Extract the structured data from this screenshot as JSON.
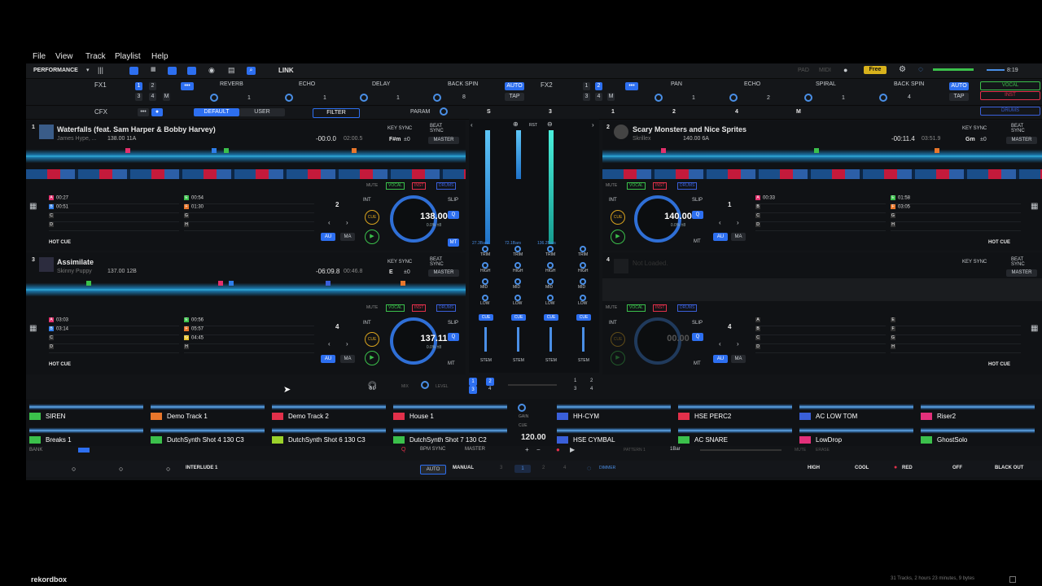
{
  "menu": [
    "File",
    "View",
    "Track",
    "Playlist",
    "Help"
  ],
  "toolbar": {
    "mode": "PERFORMANCE",
    "zoom": "100%",
    "link": "LINK",
    "pad": "PAD",
    "midi": "MIDI",
    "plan": "Free",
    "clock": "8:19"
  },
  "fx1": {
    "label": "FX1",
    "effects": [
      "REVERB",
      "ECHO",
      "DELAY",
      "BACK SPIN"
    ],
    "beat_values": [
      "1",
      "1",
      "1",
      "8"
    ],
    "auto": "AUTO",
    "tap": "TAP",
    "deck_buttons": [
      "1",
      "2",
      "3",
      "4",
      "M"
    ]
  },
  "fx2": {
    "label": "FX2",
    "effects": [
      "PAN",
      "ECHO",
      "SPIRAL",
      "BACK SPIN"
    ],
    "beat_values": [
      "1",
      "2",
      "1",
      "4"
    ],
    "auto": "AUTO",
    "tap": "TAP",
    "deck_buttons": [
      "1",
      "2",
      "3",
      "4",
      "M"
    ]
  },
  "stem_filters": [
    "VOCAL",
    "INST",
    "DRUMS"
  ],
  "cfx": {
    "label": "CFX",
    "default": "DEFAULT",
    "user": "USER",
    "filter": "FILTER",
    "param": "PARAM",
    "s": "S",
    "nums": [
      "3",
      "1",
      "2",
      "4",
      "M"
    ]
  },
  "decks": [
    {
      "num": "1",
      "title": "Waterfalls (feat. Sam Harper & Bobby Harvey)",
      "artist": "James Hype, ...",
      "bpm_key": "138.00  11A",
      "remain": "-00:0.0",
      "total": "02:00.5",
      "key": "F#m",
      "keyoff": "±0",
      "jog_bpm": "138.00",
      "jog_sub": "0.0% ±8",
      "beat_num": "2",
      "hotcues": [
        {
          "l": "A",
          "t": "00:27",
          "c": "#e2306c"
        },
        {
          "l": "B",
          "t": "00:51",
          "c": "#2e7de9"
        },
        {
          "l": "C",
          "t": "",
          "c": "#333"
        },
        {
          "l": "D",
          "t": "",
          "c": "#333"
        },
        {
          "l": "E",
          "t": "00:54",
          "c": "#3bc04b"
        },
        {
          "l": "F",
          "t": "01:30",
          "c": "#e8762b"
        },
        {
          "l": "G",
          "t": "",
          "c": "#333"
        },
        {
          "l": "H",
          "t": "",
          "c": "#333"
        }
      ]
    },
    {
      "num": "2",
      "title": "Scary Monsters and Nice Sprites",
      "artist": "Skrillex",
      "bpm_key": "140.00  6A",
      "remain": "-00:11.4",
      "total": "03:51.9",
      "key": "Gm",
      "keyoff": "±0",
      "jog_bpm": "140.00",
      "jog_sub": "0.0% ±8",
      "beat_num": "1",
      "hotcues": [
        {
          "l": "A",
          "t": "00:33",
          "c": "#e2306c"
        },
        {
          "l": "B",
          "t": "",
          "c": "#333"
        },
        {
          "l": "C",
          "t": "",
          "c": "#333"
        },
        {
          "l": "D",
          "t": "",
          "c": "#333"
        },
        {
          "l": "E",
          "t": "01:58",
          "c": "#3bc04b"
        },
        {
          "l": "F",
          "t": "03:05",
          "c": "#e8762b"
        },
        {
          "l": "G",
          "t": "",
          "c": "#333"
        },
        {
          "l": "H",
          "t": "",
          "c": "#333"
        }
      ]
    },
    {
      "num": "3",
      "title": "Assimilate",
      "artist": "Skinny Puppy",
      "bpm_key": "137.00  12B",
      "remain": "-06:09.8",
      "total": "00:46.8",
      "key": "E",
      "keyoff": "±0",
      "jog_bpm": "137.11",
      "jog_sub": "0.0% ±8",
      "beat_num": "4",
      "hotcues": [
        {
          "l": "A",
          "t": "03:03",
          "c": "#e2306c"
        },
        {
          "l": "B",
          "t": "03:14",
          "c": "#2e7de9"
        },
        {
          "l": "C",
          "t": "",
          "c": "#333"
        },
        {
          "l": "D",
          "t": "",
          "c": "#333"
        },
        {
          "l": "E",
          "t": "00:56",
          "c": "#3bc04b"
        },
        {
          "l": "F",
          "t": "05:57",
          "c": "#e8762b"
        },
        {
          "l": "G",
          "t": "04:45",
          "c": "#e8c42b"
        },
        {
          "l": "H",
          "t": "",
          "c": "#333"
        }
      ]
    },
    {
      "num": "4",
      "title": "Not Loaded.",
      "jog_bpm": "00.00",
      "beat_num": "4",
      "hotcues": [
        {
          "l": "A",
          "t": "",
          "c": "#333"
        },
        {
          "l": "B",
          "t": "",
          "c": "#333"
        },
        {
          "l": "C",
          "t": "",
          "c": "#333"
        },
        {
          "l": "D",
          "t": "",
          "c": "#333"
        },
        {
          "l": "E",
          "t": "",
          "c": "#333"
        },
        {
          "l": "F",
          "t": "",
          "c": "#333"
        },
        {
          "l": "G",
          "t": "",
          "c": "#333"
        },
        {
          "l": "H",
          "t": "",
          "c": "#333"
        }
      ]
    }
  ],
  "deck_ui": {
    "key_sync": "KEY SYNC",
    "beat_sync": "BEAT SYNC",
    "master": "MASTER",
    "mute": "MUTE",
    "hot_cue": "HOT CUE",
    "int": "INT",
    "slip": "SLIP",
    "q": "Q",
    "mt": "MT",
    "au": "AU",
    "ma": "MA",
    "cue": "CUE"
  },
  "mixer": {
    "bars_left": "27.3Bars",
    "bars_mid": "72.1Bars",
    "bars_right": "136.2Bars",
    "rst": "RST",
    "trim": "TRIM",
    "high": "HIGH",
    "mid": "MID",
    "low": "LOW",
    "cue": "CUE",
    "stem": "STEM",
    "mix": "MIX",
    "level": "LEVEL"
  },
  "sampler": {
    "slots": [
      {
        "name": "SIREN",
        "color": "#3bc04b"
      },
      {
        "name": "Demo Track 1",
        "color": "#e8762b"
      },
      {
        "name": "Demo Track 2",
        "color": "#e2304a"
      },
      {
        "name": "House 1",
        "color": "#e2304a"
      },
      {
        "name": "HH-CYM",
        "color": "#3a5fd9"
      },
      {
        "name": "HSE PERC2",
        "color": "#e2304a"
      },
      {
        "name": "AC LOW TOM",
        "color": "#3a5fd9"
      },
      {
        "name": "Riser2",
        "color": "#e2307a"
      },
      {
        "name": "Breaks 1",
        "color": "#3bc04b"
      },
      {
        "name": "DutchSynth Shot 4 130 C3",
        "color": "#3bc04b"
      },
      {
        "name": "DutchSynth Shot 6 130 C3",
        "color": "#9bd22b"
      },
      {
        "name": "DutchSynth Shot 7 130 C2",
        "color": "#3bc04b"
      },
      {
        "name": "HSE CYMBAL",
        "color": "#3a5fd9"
      },
      {
        "name": "AC SNARE",
        "color": "#3bc04b"
      },
      {
        "name": "LowDrop",
        "color": "#e2307a"
      },
      {
        "name": "GhostSolo",
        "color": "#3bc04b"
      }
    ],
    "bank": "BANK",
    "gain": "GAIN",
    "cue": "CUE",
    "bpm": "120.00",
    "bpm_sync": "BPM SYNC",
    "master": "MASTER",
    "pattern": "PATTERN 1",
    "bar": "1Bar",
    "mute": "MUTE",
    "erase": "ERASE"
  },
  "bottom": {
    "interlude": "INTERLUDE 1",
    "auto": "AUTO",
    "manual": "MANUAL",
    "pages": [
      "3",
      "1",
      "2",
      "4"
    ],
    "dimmer": "DIMMER",
    "high": "HIGH",
    "cool": "COOL",
    "red": "RED",
    "off": "OFF",
    "blackout": "BLACK OUT"
  },
  "footer": {
    "brand": "rekordbox",
    "status": "31 Tracks, 2 hours 23 minutes, 9 bytes"
  }
}
